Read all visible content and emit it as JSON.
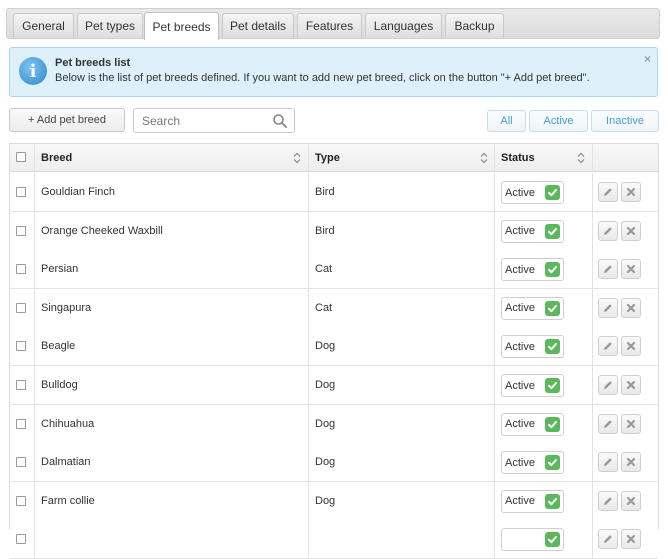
{
  "tabs": [
    {
      "label": "General",
      "active": false
    },
    {
      "label": "Pet types",
      "active": false
    },
    {
      "label": "Pet breeds",
      "active": true
    },
    {
      "label": "Pet details",
      "active": false
    },
    {
      "label": "Features",
      "active": false
    },
    {
      "label": "Languages",
      "active": false
    },
    {
      "label": "Backup",
      "active": false
    }
  ],
  "info": {
    "title": "Pet breeds list",
    "text": "Below is the list of pet breeds defined. If you want to add new pet breed, click on the button \"+ Add pet breed\".",
    "close": "×"
  },
  "toolbar": {
    "add_label": "+ Add pet breed",
    "search_placeholder": "Search",
    "filters": [
      "All",
      "Active",
      "Inactive"
    ]
  },
  "table": {
    "columns": [
      "Breed",
      "Type",
      "Status"
    ],
    "rows": [
      {
        "breed": "Gouldian Finch",
        "type": "Bird",
        "status": "Active"
      },
      {
        "breed": "Orange Cheeked Waxbill",
        "type": "Bird",
        "status": "Active"
      },
      {
        "breed": "Persian",
        "type": "Cat",
        "status": "Active"
      },
      {
        "breed": "Singapura",
        "type": "Cat",
        "status": "Active"
      },
      {
        "breed": "Beagle",
        "type": "Dog",
        "status": "Active"
      },
      {
        "breed": "Bulldog",
        "type": "Dog",
        "status": "Active"
      },
      {
        "breed": "Chihuahua",
        "type": "Dog",
        "status": "Active"
      },
      {
        "breed": "Dalmatian",
        "type": "Dog",
        "status": "Active"
      },
      {
        "breed": "Farm collie",
        "type": "Dog",
        "status": "Active"
      },
      {
        "breed": "",
        "type": "",
        "status": ""
      }
    ]
  },
  "icons": {
    "info": "info-icon",
    "search": "search-icon",
    "sort": "sort-icon",
    "check": "check-icon",
    "edit": "pencil-icon",
    "delete": "close-icon"
  },
  "colors": {
    "info_bg": "#def1fb",
    "accent": "#4a9ad3",
    "status_ok": "#5cb85c"
  }
}
